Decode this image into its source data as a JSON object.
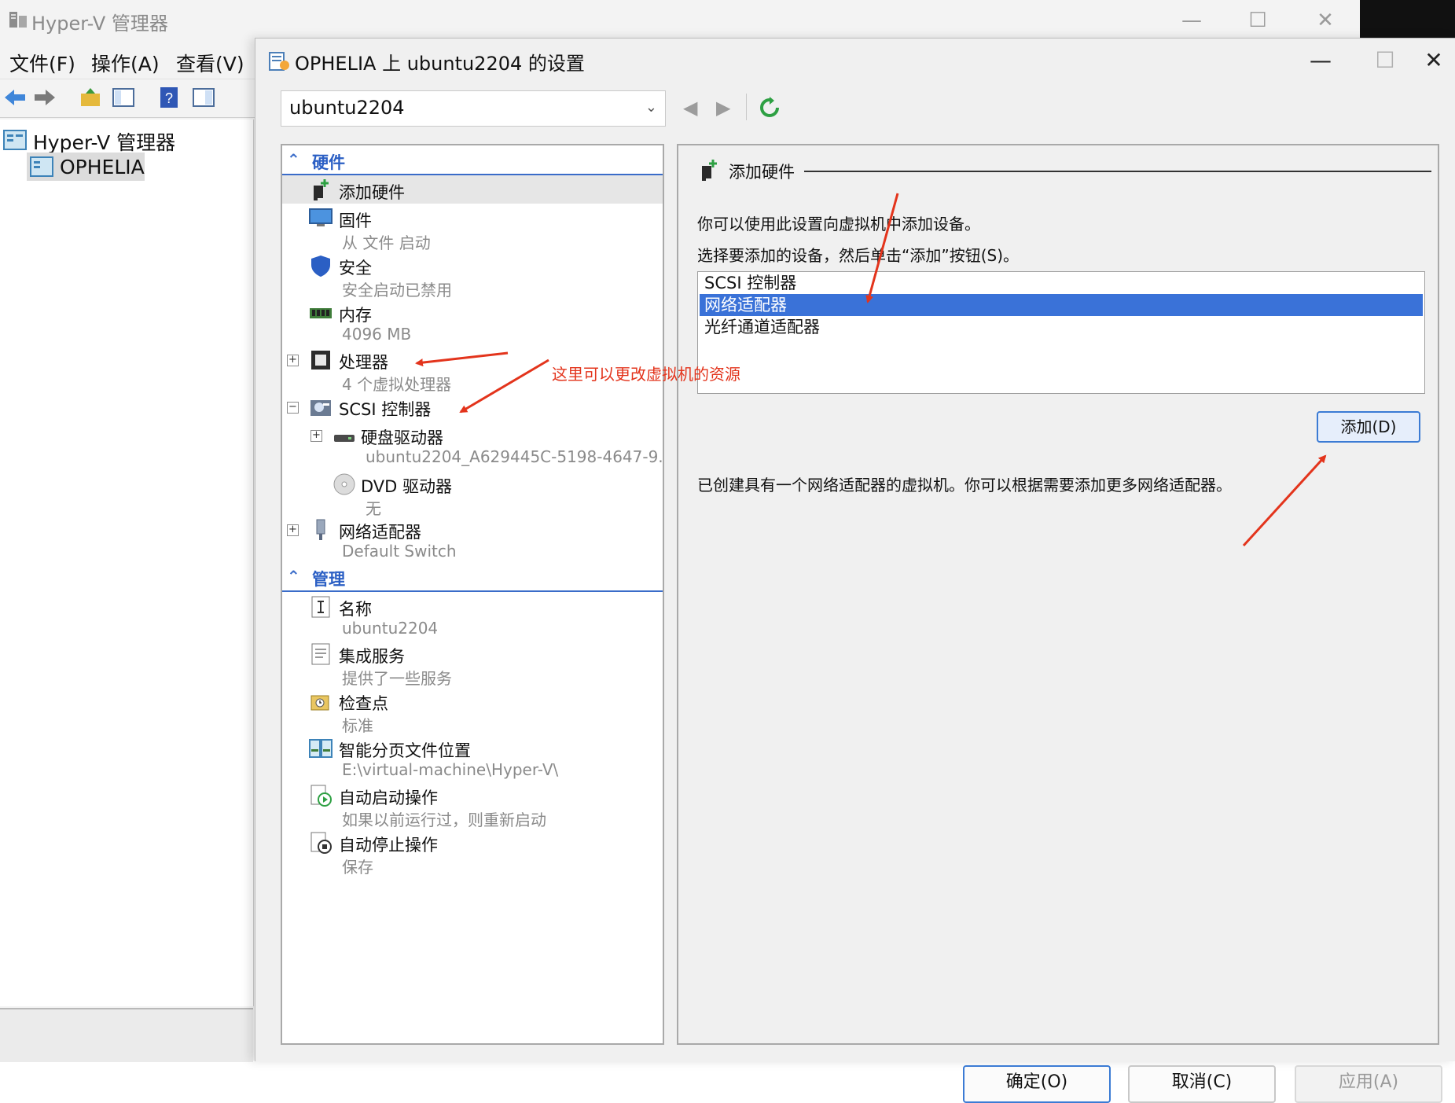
{
  "manager": {
    "title": "Hyper-V 管理器",
    "menu": [
      "文件(F)",
      "操作(A)",
      "查看(V)"
    ],
    "tree": {
      "root": "Hyper-V 管理器",
      "host": "OPHELIA"
    }
  },
  "dialog": {
    "title": "OPHELIA 上 ubuntu2204 的设置",
    "vm_selected": "ubuntu2204",
    "sections": {
      "hardware": "硬件",
      "management": "管理"
    },
    "hardware_items": [
      {
        "name": "添加硬件",
        "sub": ""
      },
      {
        "name": "固件",
        "sub": "从 文件 启动"
      },
      {
        "name": "安全",
        "sub": "安全启动已禁用"
      },
      {
        "name": "内存",
        "sub": "4096 MB"
      },
      {
        "name": "处理器",
        "sub": "4 个虚拟处理器"
      },
      {
        "name": "SCSI 控制器",
        "sub": ""
      },
      {
        "name": "硬盘驱动器",
        "sub": "ubuntu2204_A629445C-5198-4647-9..."
      },
      {
        "name": "DVD 驱动器",
        "sub": "无"
      },
      {
        "name": "网络适配器",
        "sub": "Default Switch"
      }
    ],
    "management_items": [
      {
        "name": "名称",
        "sub": "ubuntu2204"
      },
      {
        "name": "集成服务",
        "sub": "提供了一些服务"
      },
      {
        "name": "检查点",
        "sub": "标准"
      },
      {
        "name": "智能分页文件位置",
        "sub": "E:\\virtual-machine\\Hyper-V\\"
      },
      {
        "name": "自动启动操作",
        "sub": "如果以前运行过，则重新启动"
      },
      {
        "name": "自动停止操作",
        "sub": "保存"
      }
    ],
    "right": {
      "header": "添加硬件",
      "desc1": "你可以使用此设置向虚拟机中添加设备。",
      "desc2": "选择要添加的设备，然后单击“添加”按钮(S)。",
      "devices": [
        "SCSI 控制器",
        "网络适配器",
        "光纤通道适配器"
      ],
      "selected_device": "网络适配器",
      "add_button": "添加(D)",
      "note": "已创建具有一个网络适配器的虚拟机。你可以根据需要添加更多网络适配器。"
    },
    "buttons": {
      "ok": "确定(O)",
      "cancel": "取消(C)",
      "apply": "应用(A)"
    }
  },
  "annotation": {
    "text": "这里可以更改虚拟机的资源",
    "color": "#e3341c"
  },
  "colors": {
    "accent": "#3a72d8",
    "section": "#2b5fc4",
    "annotation": "#e3341c"
  }
}
